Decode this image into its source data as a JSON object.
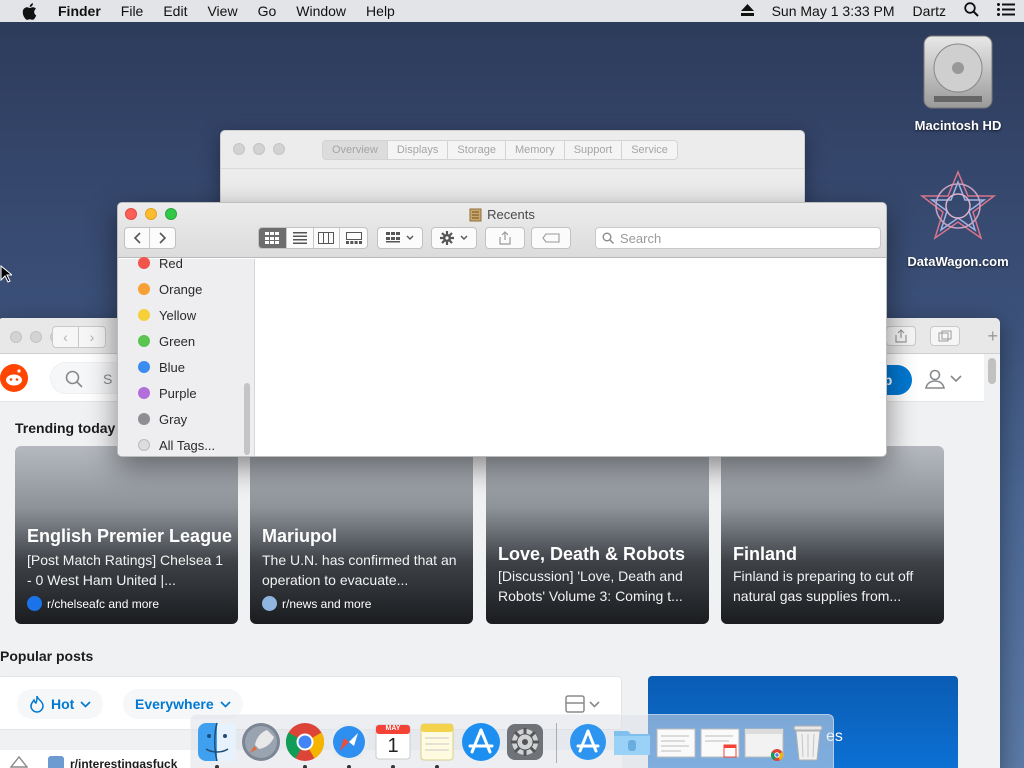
{
  "menubar": {
    "app": "Finder",
    "items": [
      "File",
      "Edit",
      "View",
      "Go",
      "Window",
      "Help"
    ],
    "datetime": "Sun May 1  3:33 PM",
    "user": "Dartz"
  },
  "desktop": {
    "icons": [
      {
        "label": "Macintosh HD",
        "icon": "hard-drive-icon"
      },
      {
        "label": "DataWagon.com",
        "icon": "network-server-icon"
      }
    ]
  },
  "sysinfo": {
    "tabs": [
      "Overview",
      "Displays",
      "Storage",
      "Memory",
      "Support",
      "Service"
    ]
  },
  "finder": {
    "title": "Recents",
    "search_placeholder": "Search",
    "tags": [
      {
        "label": "Red",
        "color": "#f0544c"
      },
      {
        "label": "Orange",
        "color": "#f7a035"
      },
      {
        "label": "Yellow",
        "color": "#f7cf3a"
      },
      {
        "label": "Green",
        "color": "#5ac451"
      },
      {
        "label": "Blue",
        "color": "#3b8cf1"
      },
      {
        "label": "Purple",
        "color": "#b26fdb"
      },
      {
        "label": "Gray",
        "color": "#8e8e93"
      },
      {
        "label": "All Tags...",
        "color": "#dcdcdc"
      }
    ]
  },
  "reddit": {
    "search_placeholder": "S",
    "signup_label": "p",
    "trending_title": "Trending today",
    "cards": [
      {
        "title": "English Premier League",
        "desc": "[Post Match Ratings] Chelsea 1 - 0 West Ham United |...",
        "sub": "r/chelseafc and more",
        "sub_color": "#1a73e8"
      },
      {
        "title": "Mariupol",
        "desc": "The U.N. has confirmed that an operation to evacuate...",
        "sub": "r/news and more",
        "sub_color": "#8fb5e0"
      },
      {
        "title": "Love, Death & Robots",
        "desc": "[Discussion] 'Love, Death and Robots' Volume 3: Coming t...",
        "sub": "",
        "sub_color": ""
      },
      {
        "title": "Finland",
        "desc": "Finland is preparing to cut off natural gas supplies from...",
        "sub": "",
        "sub_color": ""
      }
    ],
    "popular_title": "Popular posts",
    "filter_hot": "Hot",
    "filter_everywhere": "Everywhere",
    "promo_text": "es",
    "post_sub": "r/interestingasfuck"
  },
  "dock": {
    "apps": [
      "finder-icon",
      "launchpad-icon",
      "chrome-icon",
      "safari-icon",
      "calendar-icon",
      "notes-icon",
      "app-store-icon",
      "system-preferences-icon",
      "app-store-downloads-icon",
      "folder-icon",
      "document-icon",
      "document-calendar-icon",
      "chrome-window-icon",
      "trash-icon"
    ],
    "calendar_month": "MAY",
    "calendar_day": "1"
  }
}
